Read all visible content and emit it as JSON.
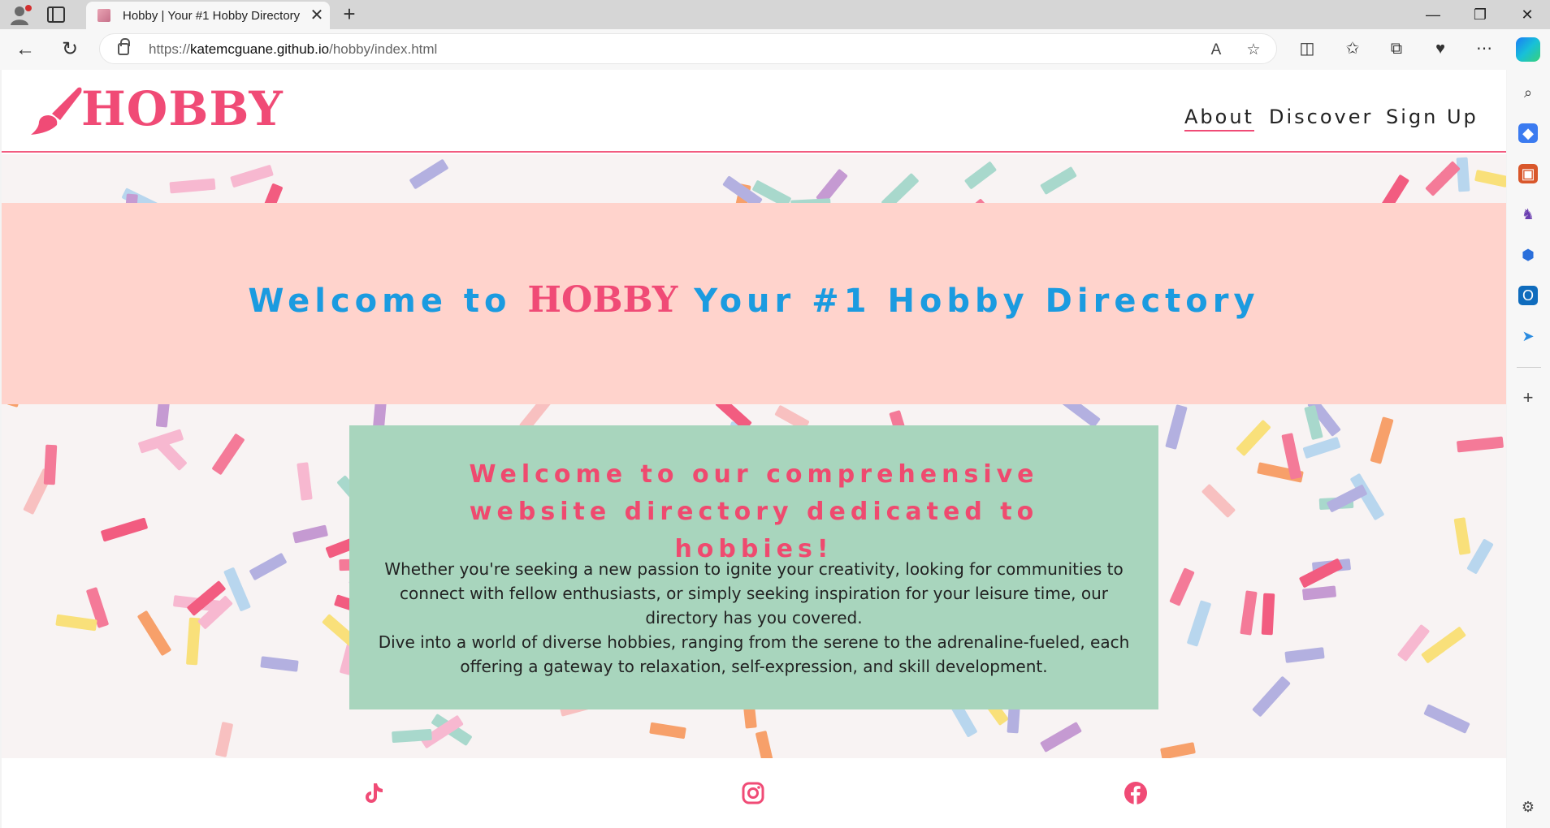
{
  "browser": {
    "tab_title": "Hobby | Your #1 Hobby Directory",
    "tab_close": "✕",
    "new_tab": "+",
    "url_prefix": "https://",
    "url_host": "katemcguane.github.io",
    "url_path": "/hobby/index.html",
    "window_controls": {
      "minimize": "—",
      "maximize": "❐",
      "close": "✕"
    }
  },
  "header": {
    "logo_text": "HOBBY",
    "nav": [
      {
        "label": "About",
        "active": true
      },
      {
        "label": "Discover",
        "active": false
      },
      {
        "label": "Sign Up",
        "active": false
      }
    ]
  },
  "hero": {
    "prefix": "Welcome to",
    "brand": "HOBBY",
    "suffix": "Your #1 Hobby Directory"
  },
  "card": {
    "title": "Welcome to our comprehensive website directory dedicated to hobbies!",
    "paragraph_1": "Whether you're seeking a new passion to ignite your creativity, looking for communities to connect with fellow enthusiasts, or simply seeking inspiration for your leisure time, our directory has you covered.",
    "paragraph_2": "Dive into a world of diverse hobbies, ranging from the serene to the adrenaline-fueled, each offering a gateway to relaxation, self-expression, and skill development."
  },
  "footer": {
    "social": [
      "tiktok-icon",
      "instagram-icon",
      "facebook-icon"
    ]
  },
  "colors": {
    "brand_pink": "#f04b76",
    "hero_blue": "#1b9be0",
    "hero_background": "#ffd3cc",
    "card_background": "#a8d5bd"
  }
}
